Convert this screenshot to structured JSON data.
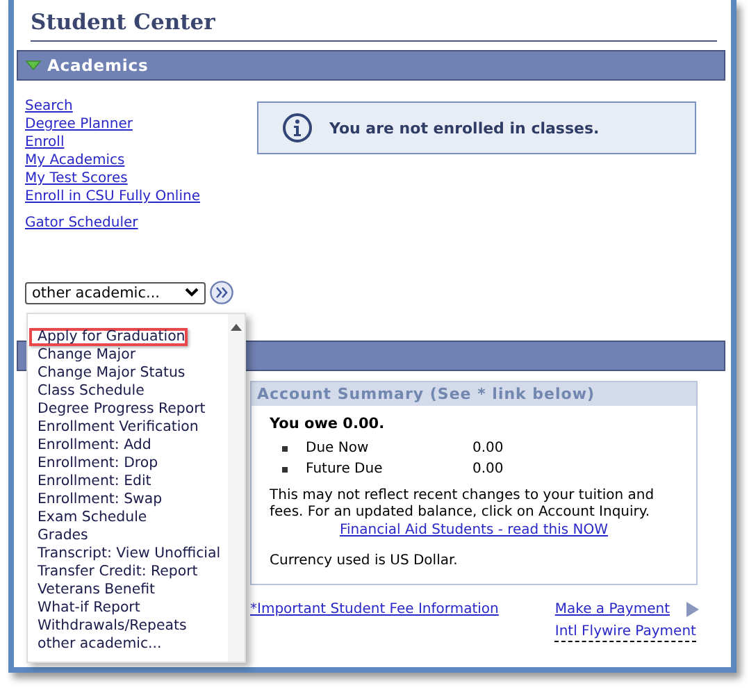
{
  "title": "Student Center",
  "section": {
    "title": "Academics",
    "expanded": true
  },
  "links": [
    "Search",
    "Degree Planner",
    "Enroll",
    "My Academics",
    "My Test Scores",
    "Enroll in CSU Fully Online"
  ],
  "extra_link": "Gator Scheduler",
  "info_message": "You are not enrolled in classes.",
  "select": {
    "value": "other academic...",
    "open": true
  },
  "dropdown_options": [
    {
      "label": "Apply for Graduation",
      "selected": true
    },
    {
      "label": "Change Major",
      "selected": false
    },
    {
      "label": "Change Major Status",
      "selected": false
    },
    {
      "label": "Class Schedule",
      "selected": false
    },
    {
      "label": "Degree Progress Report",
      "selected": false
    },
    {
      "label": "Enrollment Verification",
      "selected": false
    },
    {
      "label": "Enrollment: Add",
      "selected": false
    },
    {
      "label": "Enrollment: Drop",
      "selected": false
    },
    {
      "label": "Enrollment: Edit",
      "selected": false
    },
    {
      "label": "Enrollment: Swap",
      "selected": false
    },
    {
      "label": "Exam Schedule",
      "selected": false
    },
    {
      "label": "Grades",
      "selected": false
    },
    {
      "label": "Transcript: View Unofficial",
      "selected": false
    },
    {
      "label": "Transfer Credit: Report",
      "selected": false
    },
    {
      "label": "Veterans Benefit",
      "selected": false
    },
    {
      "label": "What-if Report",
      "selected": false
    },
    {
      "label": "Withdrawals/Repeats",
      "selected": false
    },
    {
      "label": "other academic...",
      "selected": false
    }
  ],
  "account_summary": {
    "title": "Account Summary (See * link below)",
    "owe": "You owe 0.00.",
    "items": [
      {
        "label": "Due Now",
        "amount": "0.00"
      },
      {
        "label": "Future Due",
        "amount": "0.00"
      }
    ],
    "note": "This may not reflect recent changes to your tuition and fees.  For an updated balance, click on Account Inquiry.",
    "aid_link": "Financial Aid Students - read this NOW",
    "currency": "Currency used is US Dollar."
  },
  "footer_links": {
    "fee_info": "*Important Student Fee Information",
    "payment": "Make a Payment",
    "flywire": "Intl Flywire Payment"
  }
}
